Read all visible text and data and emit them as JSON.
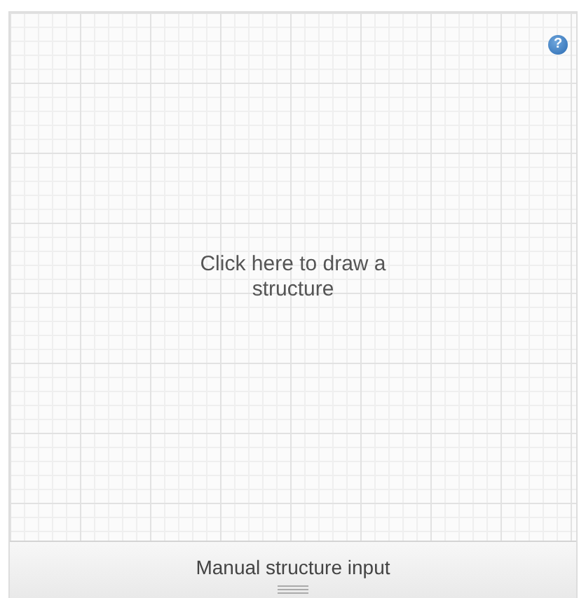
{
  "canvas": {
    "prompt": "Click here to draw a structure"
  },
  "help_button": {
    "label": "?"
  },
  "bottom_bar": {
    "label": "Manual structure input"
  }
}
